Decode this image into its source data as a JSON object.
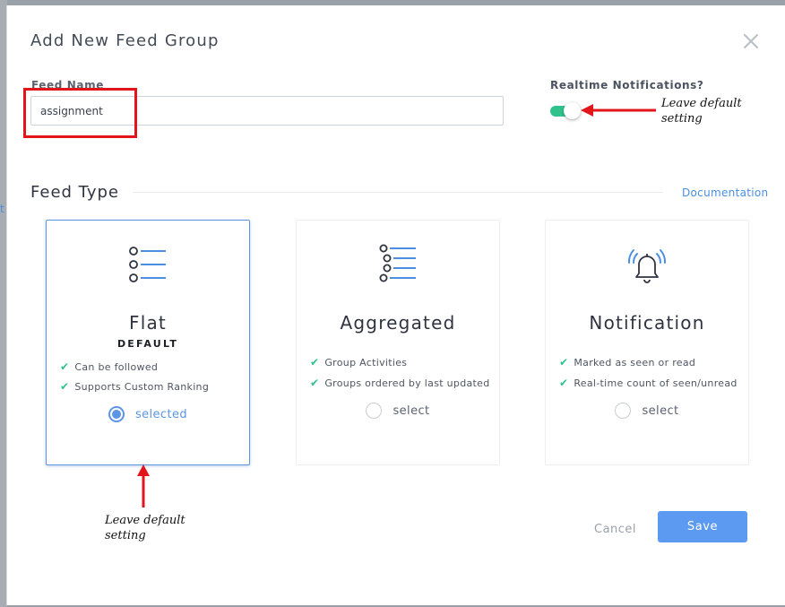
{
  "dialog": {
    "title": "Add New Feed Group",
    "close_icon": "close-icon"
  },
  "feed_name": {
    "label": "Feed Name",
    "value": "assignment"
  },
  "realtime": {
    "label": "Realtime Notifications?",
    "enabled": true
  },
  "feed_type": {
    "title": "Feed Type",
    "documentation_link": "Documentation",
    "cards": [
      {
        "name": "Flat",
        "badge": "DEFAULT",
        "icon": "flat-list-icon",
        "features": [
          "Can be followed",
          "Supports Custom Ranking"
        ],
        "radio_label": "selected",
        "selected": true
      },
      {
        "name": "Aggregated",
        "icon": "aggregated-list-icon",
        "features": [
          "Group Activities",
          "Groups ordered by last updated"
        ],
        "radio_label": "select",
        "selected": false
      },
      {
        "name": "Notification",
        "icon": "bell-ringing-icon",
        "features": [
          "Marked as seen or read",
          "Real-time count of seen/unread"
        ],
        "radio_label": "select",
        "selected": false
      }
    ]
  },
  "actions": {
    "cancel": "Cancel",
    "save": "Save"
  },
  "annotations": {
    "toggle_note": "Leave default setting",
    "card_note": "Leave default setting"
  },
  "colors": {
    "accent_blue": "#5b95e3",
    "toggle_green": "#2fc28a",
    "highlight_red": "#e2161a"
  }
}
